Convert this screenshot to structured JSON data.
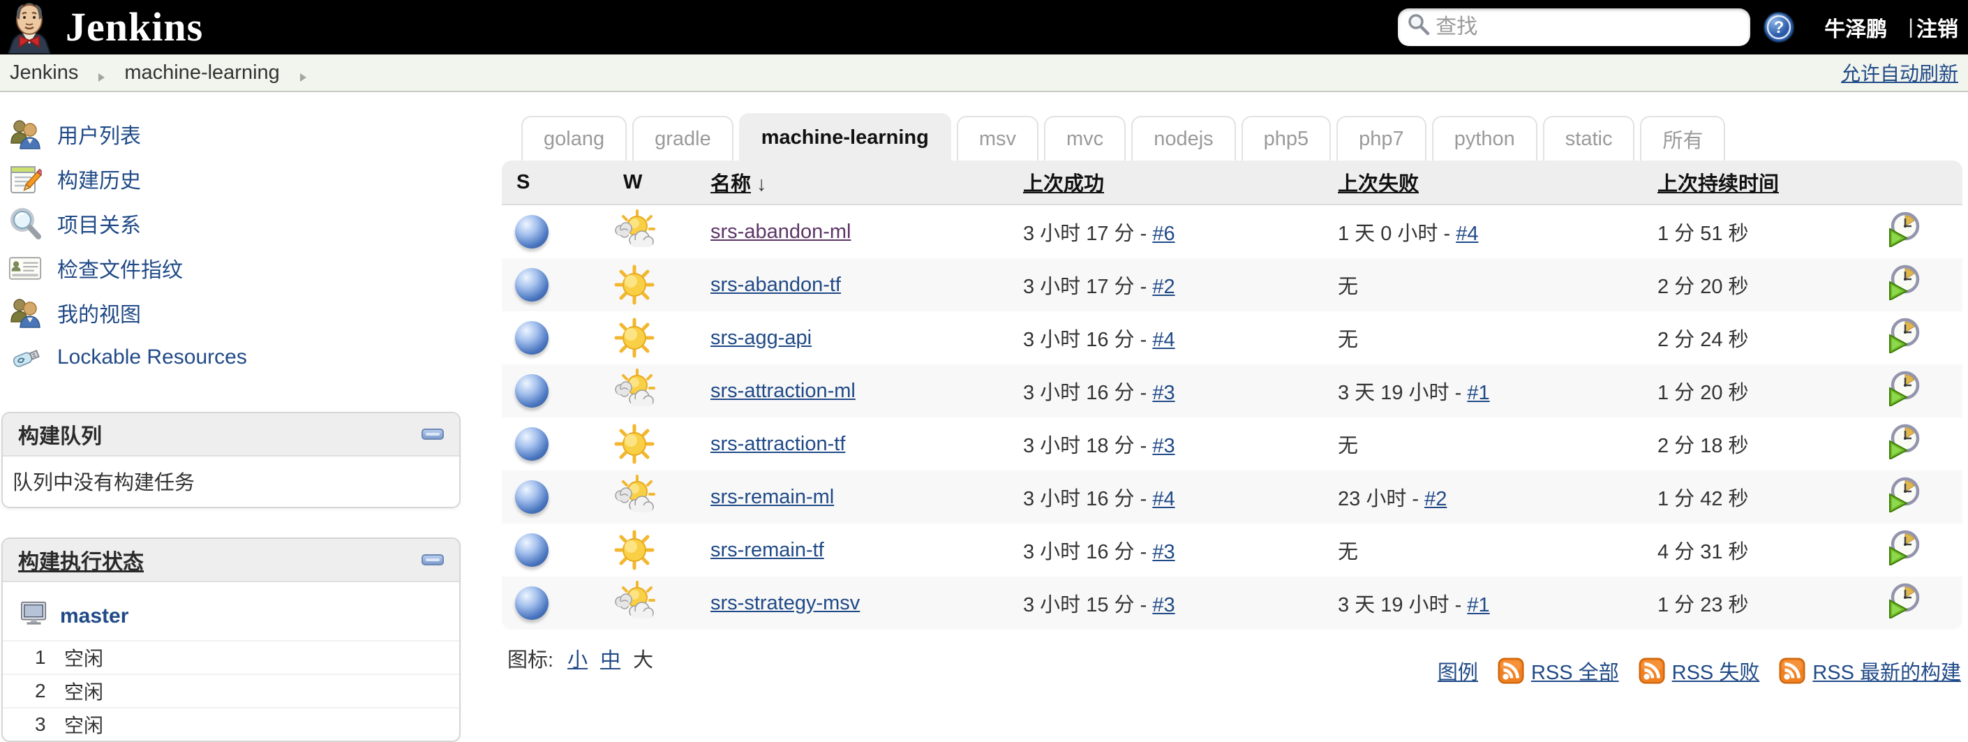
{
  "topbar": {
    "brand": "Jenkins",
    "search_placeholder": "查找",
    "user_name": "牛泽鹏",
    "separator": "|",
    "logout_label": "注销"
  },
  "breadcrumb": {
    "root": "Jenkins",
    "current": "machine-learning",
    "auto_refresh_label": "允许自动刷新"
  },
  "sidebar": {
    "tasks": [
      {
        "id": "user-list",
        "icon": "people-icon",
        "label": "用户列表"
      },
      {
        "id": "build-history",
        "icon": "notepad-icon",
        "label": "构建历史"
      },
      {
        "id": "project-relationship",
        "icon": "magnifier-icon",
        "label": "项目关系"
      },
      {
        "id": "check-file-fingerprint",
        "icon": "fingerprint-icon",
        "label": "检查文件指纹"
      },
      {
        "id": "my-views",
        "icon": "people-icon",
        "label": "我的视图"
      },
      {
        "id": "lockable-resources",
        "icon": "usb-icon",
        "label": "Lockable Resources"
      }
    ],
    "build_queue": {
      "title": "构建队列",
      "empty_message": "队列中没有构建任务"
    },
    "executor_status": {
      "title": "构建执行状态",
      "node_name": "master",
      "executors": [
        {
          "number": "1",
          "status": "空闲"
        },
        {
          "number": "2",
          "status": "空闲"
        },
        {
          "number": "3",
          "status": "空闲"
        }
      ]
    }
  },
  "tabs": [
    {
      "id": "golang",
      "label": "golang",
      "active": false
    },
    {
      "id": "gradle",
      "label": "gradle",
      "active": false
    },
    {
      "id": "machine-learning",
      "label": "machine-learning",
      "active": true
    },
    {
      "id": "msv",
      "label": "msv",
      "active": false
    },
    {
      "id": "mvc",
      "label": "mvc",
      "active": false
    },
    {
      "id": "nodejs",
      "label": "nodejs",
      "active": false
    },
    {
      "id": "php5",
      "label": "php5",
      "active": false
    },
    {
      "id": "php7",
      "label": "php7",
      "active": false
    },
    {
      "id": "python",
      "label": "python",
      "active": false
    },
    {
      "id": "static",
      "label": "static",
      "active": false
    },
    {
      "id": "all",
      "label": "所有",
      "active": false
    }
  ],
  "table": {
    "headers": {
      "s": "S",
      "w": "W",
      "name": "名称",
      "sort_arrow": "↓",
      "last_success": "上次成功",
      "last_failure": "上次失败",
      "last_duration": "上次持续时间"
    },
    "link_separator": " - ",
    "none_label": "无",
    "rows": [
      {
        "name": "srs-abandon-ml",
        "visited": true,
        "status": "blue",
        "weather": "partly-cloudy",
        "success_time": "3 小时 17 分",
        "success_build": "#6",
        "failure_time": "1 天 0 小时",
        "failure_build": "#4",
        "duration": "1 分 51 秒"
      },
      {
        "name": "srs-abandon-tf",
        "visited": false,
        "status": "blue",
        "weather": "sunny",
        "success_time": "3 小时 17 分",
        "success_build": "#2",
        "failure_time": null,
        "failure_build": null,
        "duration": "2 分 20 秒"
      },
      {
        "name": "srs-agg-api",
        "visited": false,
        "status": "blue",
        "weather": "sunny",
        "success_time": "3 小时 16 分",
        "success_build": "#4",
        "failure_time": null,
        "failure_build": null,
        "duration": "2 分 24 秒"
      },
      {
        "name": "srs-attraction-ml",
        "visited": false,
        "status": "blue",
        "weather": "partly-cloudy",
        "success_time": "3 小时 16 分",
        "success_build": "#3",
        "failure_time": "3 天 19 小时",
        "failure_build": "#1",
        "duration": "1 分 20 秒"
      },
      {
        "name": "srs-attraction-tf",
        "visited": false,
        "status": "blue",
        "weather": "sunny",
        "success_time": "3 小时 18 分",
        "success_build": "#3",
        "failure_time": null,
        "failure_build": null,
        "duration": "2 分 18 秒"
      },
      {
        "name": "srs-remain-ml",
        "visited": false,
        "status": "blue",
        "weather": "partly-cloudy",
        "success_time": "3 小时 16 分",
        "success_build": "#4",
        "failure_time": "23 小时",
        "failure_build": "#2",
        "duration": "1 分 42 秒"
      },
      {
        "name": "srs-remain-tf",
        "visited": false,
        "status": "blue",
        "weather": "sunny",
        "success_time": "3 小时 16 分",
        "success_build": "#3",
        "failure_time": null,
        "failure_build": null,
        "duration": "4 分 31 秒"
      },
      {
        "name": "srs-strategy-msv",
        "visited": false,
        "status": "blue",
        "weather": "partly-cloudy",
        "success_time": "3 小时 15 分",
        "success_build": "#3",
        "failure_time": "3 天 19 小时",
        "failure_build": "#1",
        "duration": "1 分 23 秒"
      }
    ]
  },
  "footer": {
    "icon_size_label": "图标:",
    "icon_sizes": [
      {
        "label": "小",
        "current": false
      },
      {
        "label": "中",
        "current": false
      },
      {
        "label": "大",
        "current": true
      }
    ],
    "legend_label": "图例",
    "rss_links": [
      {
        "label": "RSS 全部"
      },
      {
        "label": "RSS 失败"
      },
      {
        "label": "RSS 最新的构建"
      }
    ]
  },
  "colors": {
    "topbar_black": "#000000",
    "link_blue": "#204a87",
    "visited_purple": "#5c3566",
    "rss_orange": "#ee7600",
    "status_ball_blue": "#3e6db5",
    "active_tab_bg": "#eeeeee",
    "breadcrumb_bg": "#f2f5ee"
  }
}
